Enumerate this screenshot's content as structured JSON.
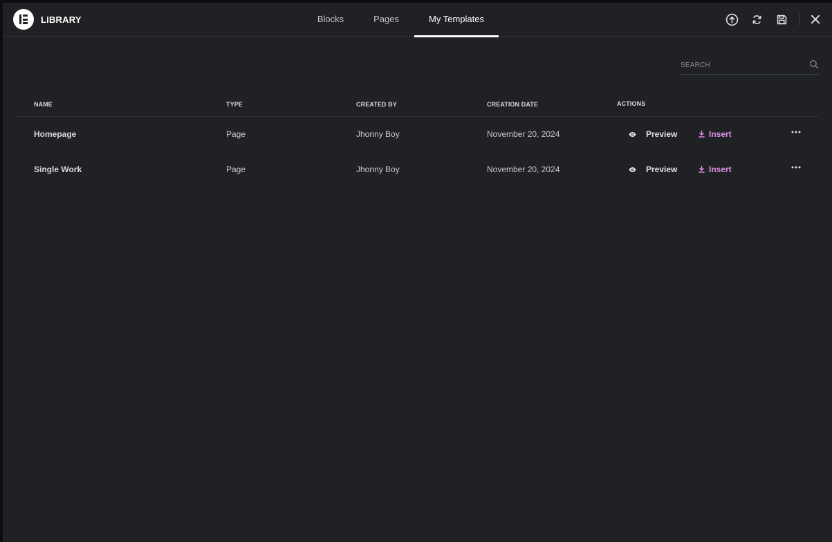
{
  "header": {
    "title": "LIBRARY",
    "tabs": [
      {
        "label": "Blocks",
        "active": false
      },
      {
        "label": "Pages",
        "active": false
      },
      {
        "label": "My Templates",
        "active": true
      }
    ],
    "tools": [
      "upload-icon",
      "sync-icon",
      "save-icon",
      "close-icon"
    ]
  },
  "search": {
    "placeholder": "SEARCH"
  },
  "table": {
    "columns": [
      "NAME",
      "TYPE",
      "CREATED BY",
      "CREATION DATE",
      "ACTIONS"
    ],
    "rows": [
      {
        "name": "Homepage",
        "type": "Page",
        "created_by": "Jhonny Boy",
        "date": "November 20, 2024",
        "preview": "Preview",
        "insert": "Insert"
      },
      {
        "name": "Single Work",
        "type": "Page",
        "created_by": "Jhonny Boy",
        "date": "November 20, 2024",
        "preview": "Preview",
        "insert": "Insert"
      }
    ]
  },
  "colors": {
    "background": "#1f2124",
    "accent": "#e08ee6",
    "text": "#e0e1e3"
  }
}
